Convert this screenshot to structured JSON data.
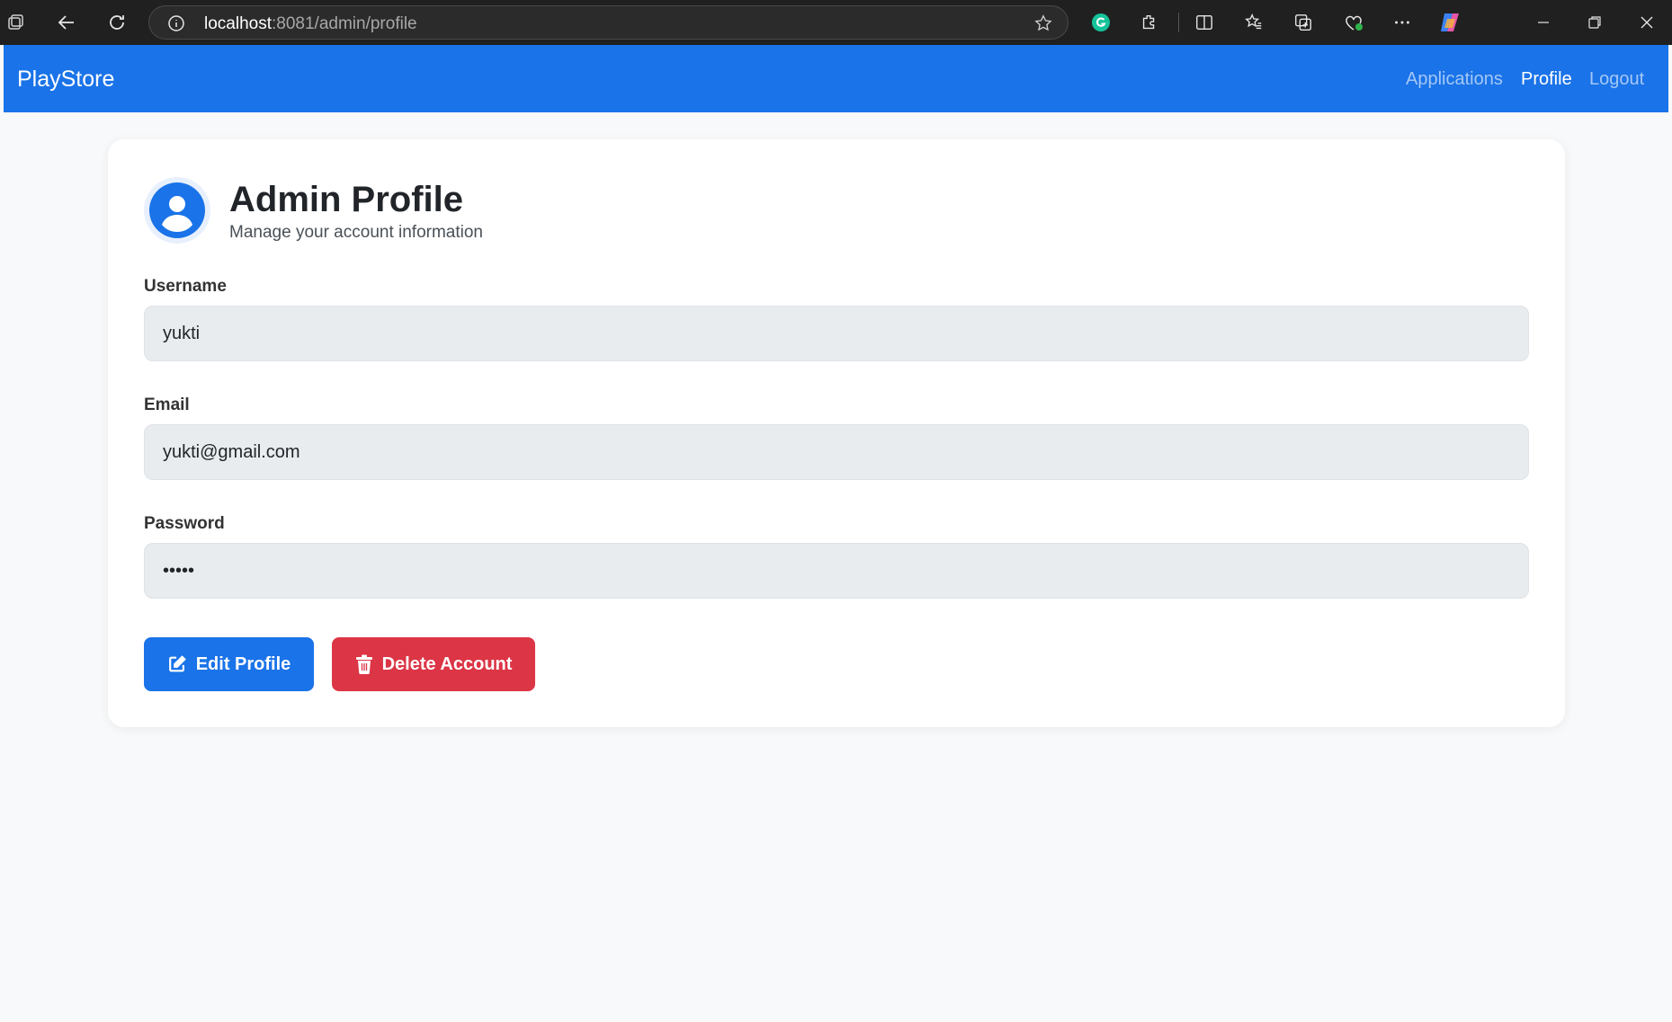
{
  "browser": {
    "url_host": "localhost",
    "url_rest": ":8081/admin/profile"
  },
  "navbar": {
    "brand": "PlayStore",
    "links": [
      {
        "label": "Applications",
        "active": false
      },
      {
        "label": "Profile",
        "active": true
      },
      {
        "label": "Logout",
        "active": false
      }
    ]
  },
  "profile": {
    "title": "Admin Profile",
    "subtitle": "Manage your account information",
    "fields": {
      "username_label": "Username",
      "username_value": "yukti",
      "email_label": "Email",
      "email_value": "yukti@gmail.com",
      "password_label": "Password",
      "password_value": "•••••"
    },
    "buttons": {
      "edit": "Edit Profile",
      "delete": "Delete Account"
    }
  },
  "colors": {
    "primary": "#1a73e8",
    "danger": "#dc3545",
    "input_bg": "#e9ecef"
  }
}
